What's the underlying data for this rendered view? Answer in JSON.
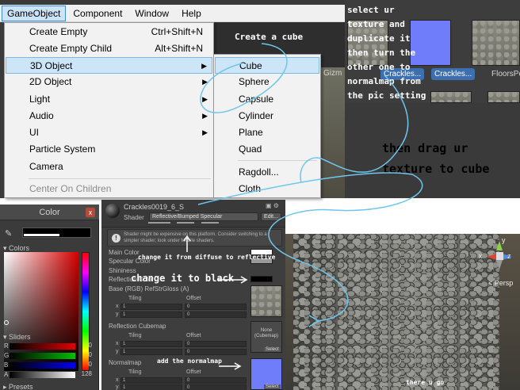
{
  "menubar": {
    "items": [
      "GameObject",
      "Component",
      "Window",
      "Help"
    ]
  },
  "dropdown": {
    "items": [
      {
        "label": "Create Empty",
        "shortcut": "Ctrl+Shift+N"
      },
      {
        "label": "Create Empty Child",
        "shortcut": "Alt+Shift+N"
      },
      {
        "label": "3D Object"
      },
      {
        "label": "2D Object"
      },
      {
        "label": "Light"
      },
      {
        "label": "Audio"
      },
      {
        "label": "UI"
      },
      {
        "label": "Particle System"
      },
      {
        "label": "Camera"
      },
      {
        "label": "Center On Children"
      }
    ],
    "submenu": [
      "Cube",
      "Sphere",
      "Capsule",
      "Cylinder",
      "Plane",
      "Quad",
      "Ragdoll...",
      "Cloth"
    ]
  },
  "annotations": {
    "create_cube": "Create a cube",
    "select_texture": [
      "select ur",
      "texture and",
      "duplicate it",
      "then turn the",
      "other one to",
      "normalmap from",
      "the pic setting"
    ],
    "drag_texture": [
      "then drag ur",
      "texture to cube"
    ],
    "diffuse_to_reflective": "change it from diffuse to reflective",
    "change_black": "change it to black",
    "add_normalmap": "add the normalmap",
    "there_u_go": "there u go"
  },
  "assets": {
    "labels": [
      "Crackles...",
      "Crackles...",
      "FloorsPo"
    ],
    "partial_label": "man",
    "gizmo_label": "Gizm"
  },
  "color_window": {
    "title": "Color",
    "close": "x",
    "colors_label": "Colors",
    "sliders_label": "Sliders",
    "sliders": [
      {
        "channel": "R",
        "value": "0",
        "color": "#c00000"
      },
      {
        "channel": "G",
        "value": "0",
        "color": "#00a000"
      },
      {
        "channel": "B",
        "value": "0",
        "color": "#0000d0"
      },
      {
        "channel": "A",
        "value": "128",
        "color": "#dddddd"
      }
    ],
    "presets": "Presets"
  },
  "inspector": {
    "material_name": "Crackles0019_6_S",
    "shader_label": "Shader",
    "shader_value": "Reflective/Bumped Specular",
    "edit_label": "Edit...",
    "warning": "Shader might be expensive on this platform. Consider switching to a simpler shader; look under Mobile shaders.",
    "props": {
      "main_color": "Main Color",
      "specular_color": "Specular Color",
      "shininess": "Shininess",
      "reflection": "Reflection Color",
      "base": "Base (RGB) RefStrGloss (A)",
      "reflection_cubemap": "Reflection Cubemap",
      "normalmap": "Normalmap"
    },
    "tiling": "Tiling",
    "offset": "Offset",
    "x": "x",
    "y": "y",
    "one": "1",
    "zero": "0",
    "select": "Select",
    "none_cubemap": [
      "None",
      "(Cubemap)"
    ]
  },
  "scene": {
    "persp": "< Persp",
    "axis_y": "y",
    "axis_x": "x",
    "axis_z": "z"
  }
}
